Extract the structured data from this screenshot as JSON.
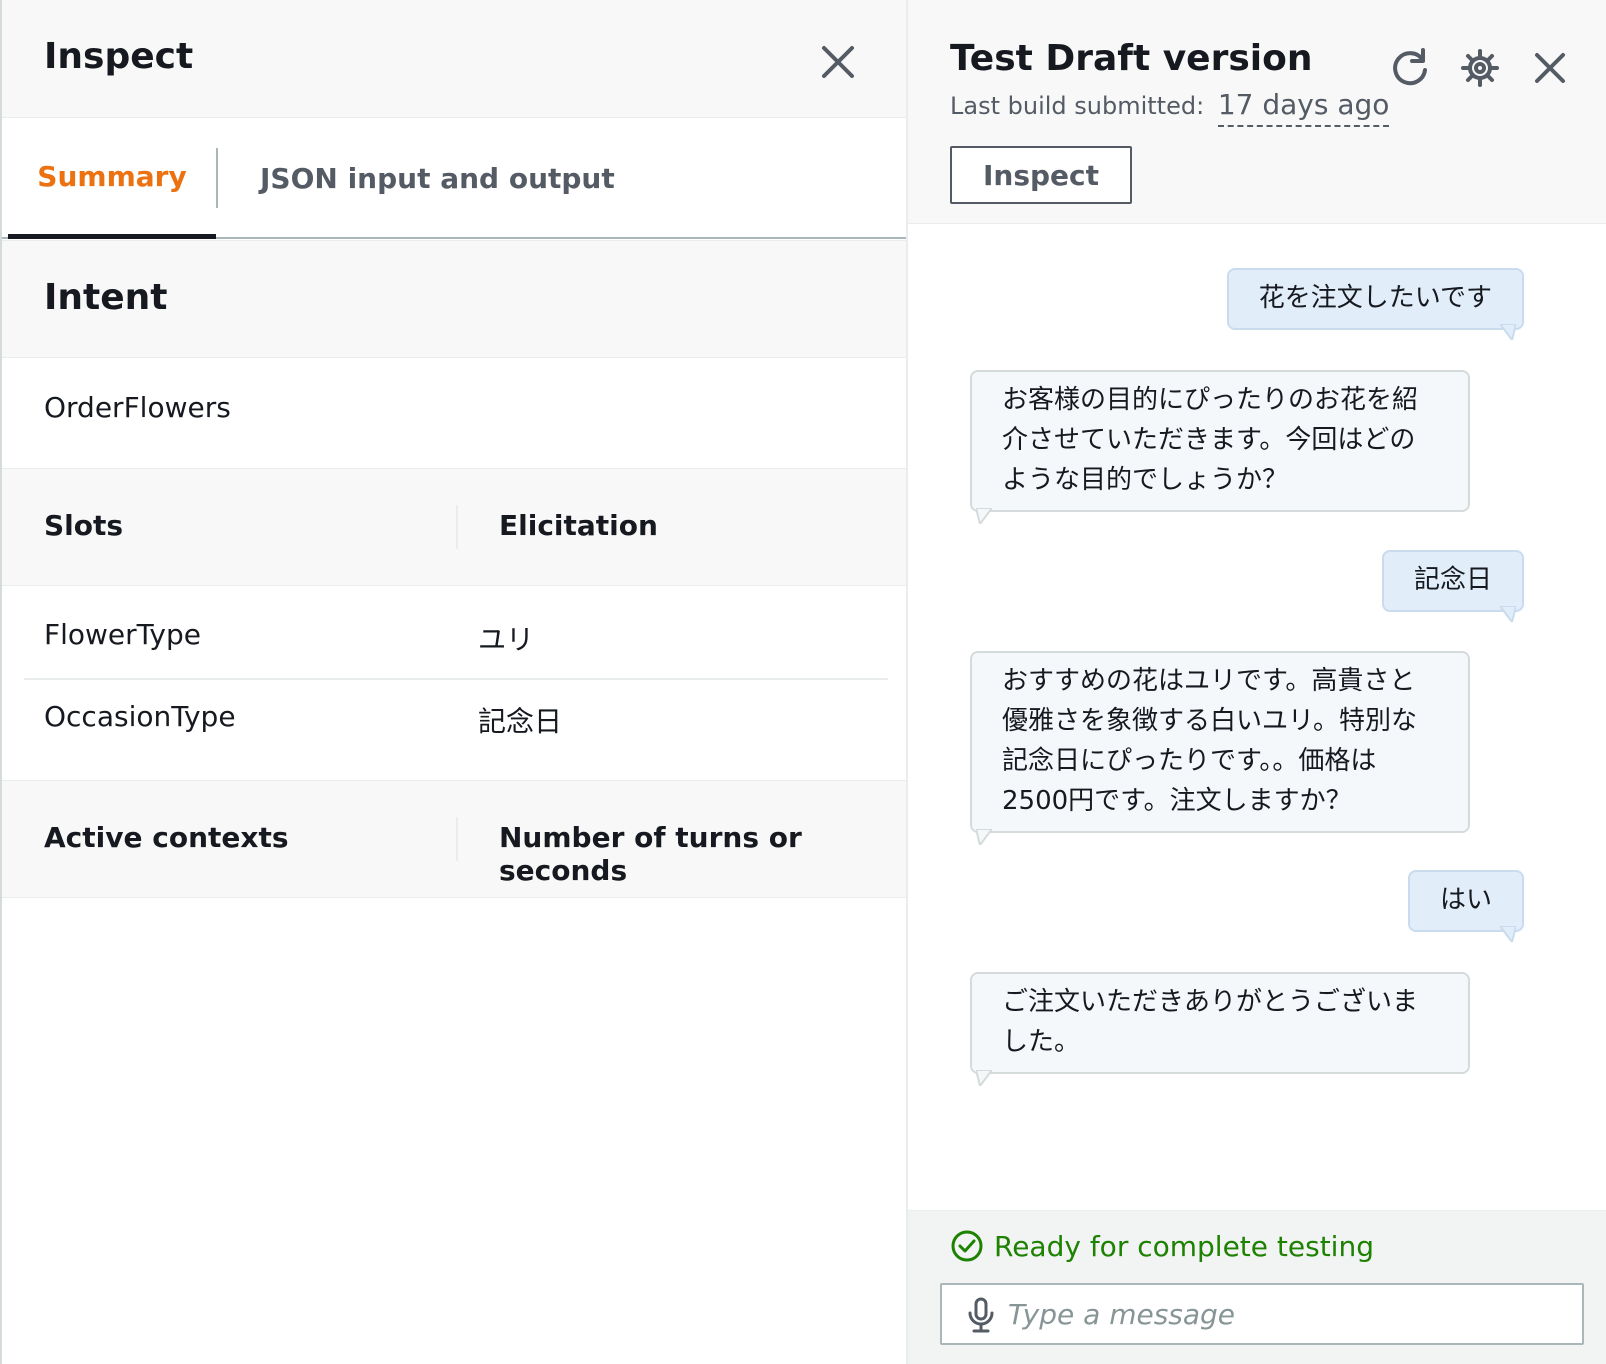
{
  "inspect_panel": {
    "title": "Inspect",
    "tabs": [
      {
        "label": "Summary",
        "active": true
      },
      {
        "label": "JSON input and output",
        "active": false
      }
    ],
    "intent": {
      "heading": "Intent",
      "value": "OrderFlowers"
    },
    "slots": {
      "headers": [
        "Slots",
        "Elicitation"
      ],
      "rows": [
        {
          "name": "FlowerType",
          "value": "ユリ"
        },
        {
          "name": "OccasionType",
          "value": "記念日"
        }
      ]
    },
    "contexts": {
      "headers": [
        "Active contexts",
        "Number of turns or seconds"
      ]
    }
  },
  "test_panel": {
    "title": "Test Draft version",
    "build_label": "Last build submitted:",
    "build_age": "17 days ago",
    "inspect_button": "Inspect",
    "icons": [
      "refresh-icon",
      "gear-icon",
      "close-icon"
    ],
    "messages": [
      {
        "role": "user",
        "text": "花を注文したいです"
      },
      {
        "role": "bot",
        "lines": [
          "お客様の目的にぴったりのお花を紹",
          "介させていただきます。今回はどの",
          "ような目的でしょうか？"
        ]
      },
      {
        "role": "user",
        "text": "記念日"
      },
      {
        "role": "bot",
        "lines": [
          "おすすめの花はユリです。高貴さと",
          "優雅さを象徴する白いユリ。特別な",
          "記念日にぴったりです。。価格は",
          "2500円です。注文しますか？"
        ]
      },
      {
        "role": "user",
        "text": "はい"
      },
      {
        "role": "bot",
        "lines": [
          "ご注文いただきありがとうございま",
          "した。"
        ]
      }
    ],
    "status": "Ready for complete testing",
    "input_placeholder": "Type a message"
  },
  "colors": {
    "accent_orange": "#ec7211",
    "status_green": "#1d8102",
    "user_bubble": "#e1edf9",
    "bot_bubble": "#f4f8fb"
  }
}
